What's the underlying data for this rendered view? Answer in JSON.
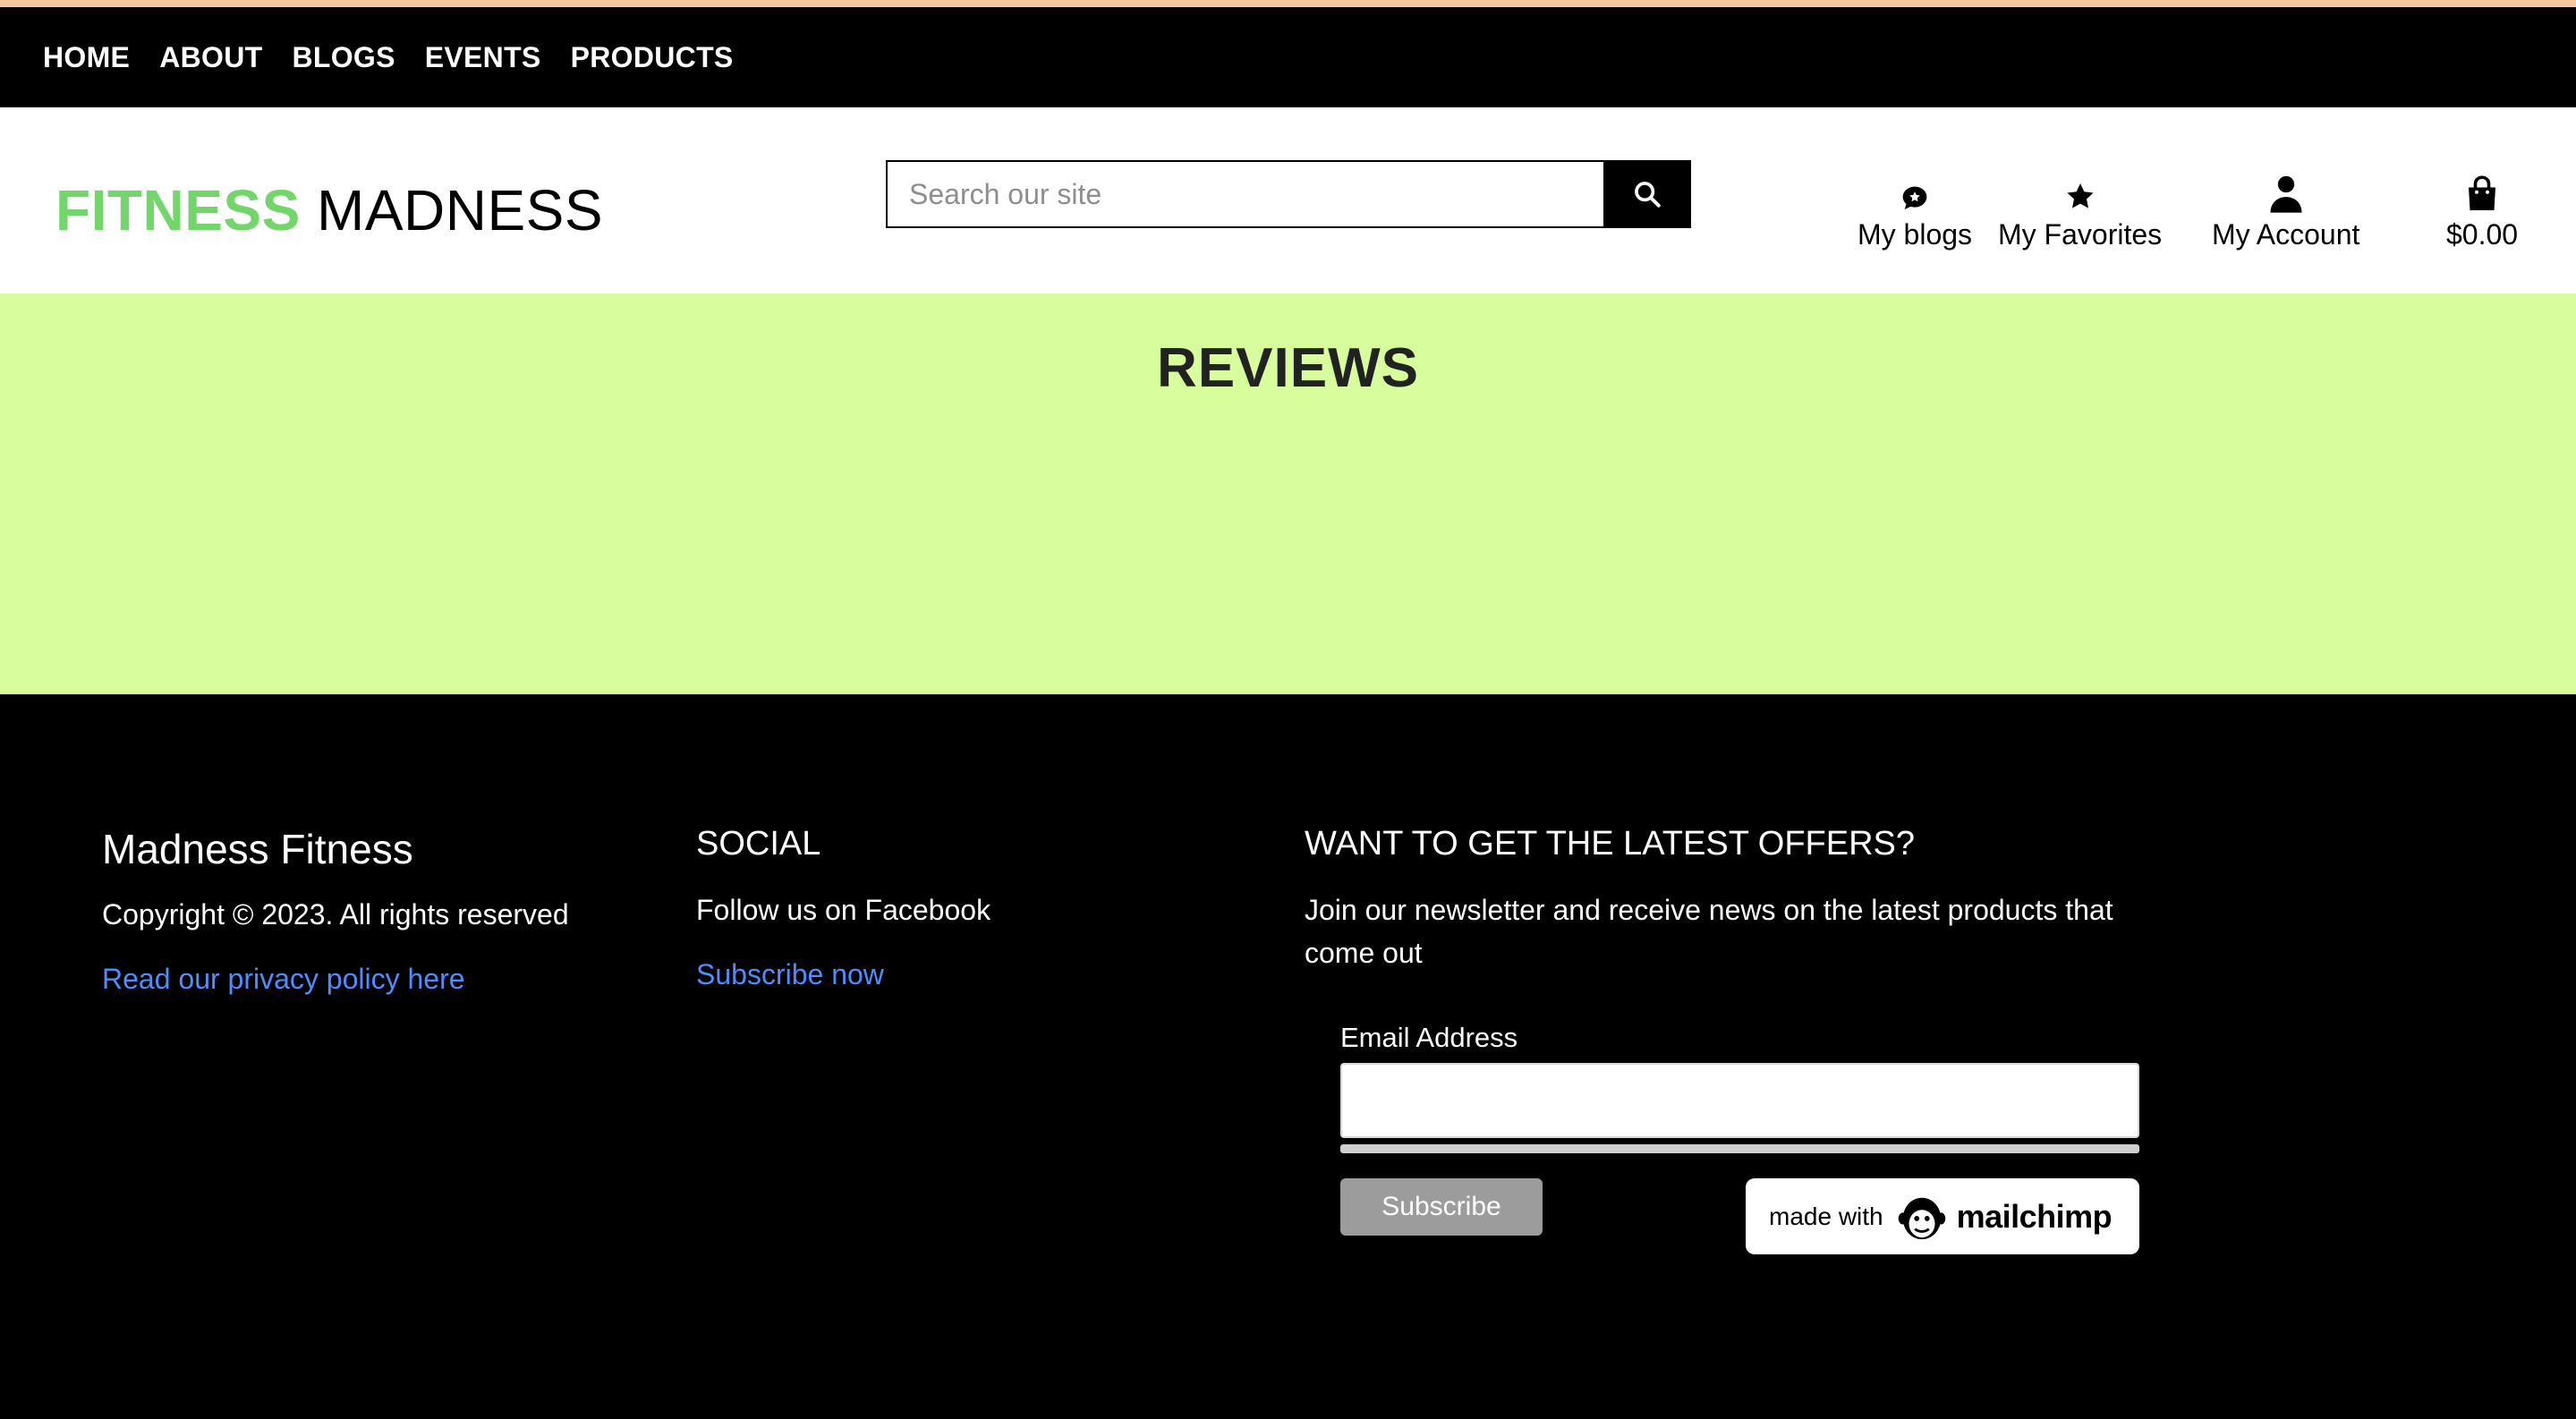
{
  "nav": {
    "items": [
      "HOME",
      "ABOUT",
      "BLOGS",
      "EVENTS",
      "PRODUCTS"
    ]
  },
  "header": {
    "logo_part1": "FITNESS",
    "logo_part2": "MADNESS",
    "search_placeholder": "Search our site",
    "my_blogs": "My blogs",
    "my_favorites": "My Favorites",
    "my_account": "My Account",
    "cart_total": "$0.00"
  },
  "reviews": {
    "title": "REVIEWS"
  },
  "footer": {
    "brand": "Madness Fitness",
    "copyright": "Copyright © 2023. All rights reserved",
    "privacy_link": "Read our privacy policy here",
    "social_title": "SOCIAL",
    "social_text": "Follow us on Facebook",
    "subscribe_link": "Subscribe now",
    "offers_title": "WANT TO GET THE LATEST OFFERS?",
    "offers_text_1": "Join our newsletter and receive news on the latest products that",
    "offers_text_2": "come out",
    "email_label": "Email Address",
    "subscribe_button": "Subscribe",
    "mailchimp_made_with": "made with",
    "mailchimp_brand": "mailchimp"
  },
  "colors": {
    "logo_green": "#73d66b",
    "reviews_bg": "#d8fd9d",
    "link_blue": "#4d8dff"
  }
}
